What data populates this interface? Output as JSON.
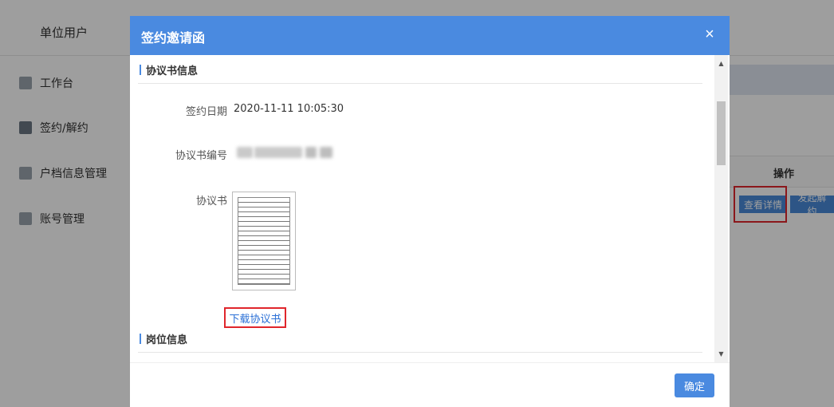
{
  "app": {
    "title": "单位用户",
    "sidebar": [
      {
        "label": "工作台",
        "icon": "dashboard-icon"
      },
      {
        "label": "签约/解约",
        "icon": "contract-icon"
      },
      {
        "label": "户档信息管理",
        "icon": "archive-icon"
      },
      {
        "label": "账号管理",
        "icon": "user-icon"
      }
    ],
    "table_header_op": "操作",
    "buttons": {
      "view_details": "查看详情",
      "start_terminate": "发起解约"
    }
  },
  "modal": {
    "title": "签约邀请函",
    "close_symbol": "×",
    "section_agreement": "协议书信息",
    "sign_date_label": "签约日期",
    "sign_date_value": "2020-11-11 10:05:30",
    "agreement_no_label": "协议书编号",
    "agreement_label": "协议书",
    "download_label": "下载协议书",
    "section_position": "岗位信息",
    "confirm_label": "确定"
  },
  "colors": {
    "accent": "#4a8ae0",
    "highlight": "#e0262c"
  }
}
